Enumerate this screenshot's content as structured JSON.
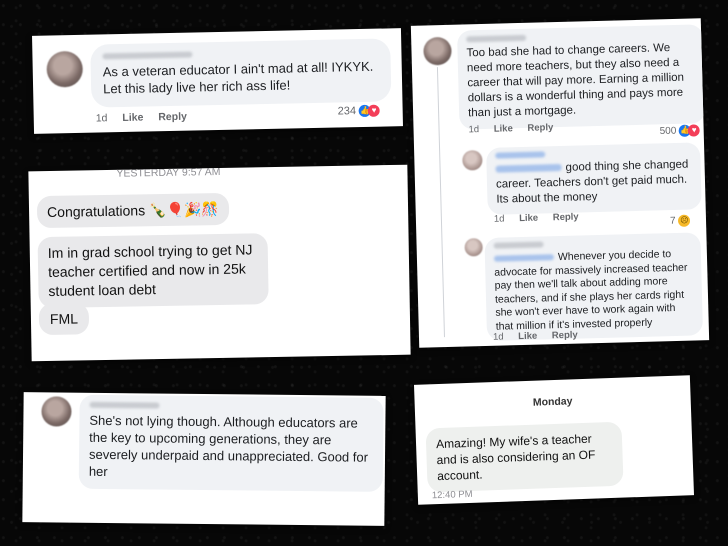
{
  "card1": {
    "text": "As a veteran educator I ain't mad at all! IYKYK. Let this lady live her rich ass life!",
    "time": "1d",
    "like": "Like",
    "reply": "Reply",
    "count": "234"
  },
  "card2": {
    "header": "YESTERDAY 9:57 AM",
    "msg1": "Congratulations 🍾🎈🎉🎊",
    "msg2": "Im in grad school trying to get NJ teacher certified and now in 25k student loan debt",
    "msg3": "FML"
  },
  "card3": {
    "text": "She's not lying though. Although educators are the key to upcoming generations, they are severely underpaid and unappreciated. Good for her"
  },
  "card4": {
    "c1": {
      "text": "Too bad she had to change careers. We need more teachers, but they also need a career that will pay more. Earning a million dollars is a wonderful thing and pays more than just a mortgage.",
      "time": "1d",
      "like": "Like",
      "reply": "Reply",
      "count": "500"
    },
    "c2": {
      "text": "good thing she changed career. Teachers don't get paid much. Its about the money",
      "time": "1d",
      "like": "Like",
      "reply": "Reply",
      "count": "7"
    },
    "c3": {
      "text": "Whenever you decide to advocate for massively increased teacher pay then we'll talk about adding more teachers, and if she plays her cards right she won't ever have to work again with that million if it's invested properly",
      "time": "1d",
      "like": "Like",
      "reply": "Reply"
    }
  },
  "card5": {
    "day": "Monday",
    "text": "Amazing!  My wife's a teacher and is also considering an OF account.",
    "time": "12:40 PM"
  },
  "colors": {
    "background": "#070707",
    "bubble": "#f0f2f5",
    "like": "#1877f2",
    "love": "#f33e58"
  }
}
